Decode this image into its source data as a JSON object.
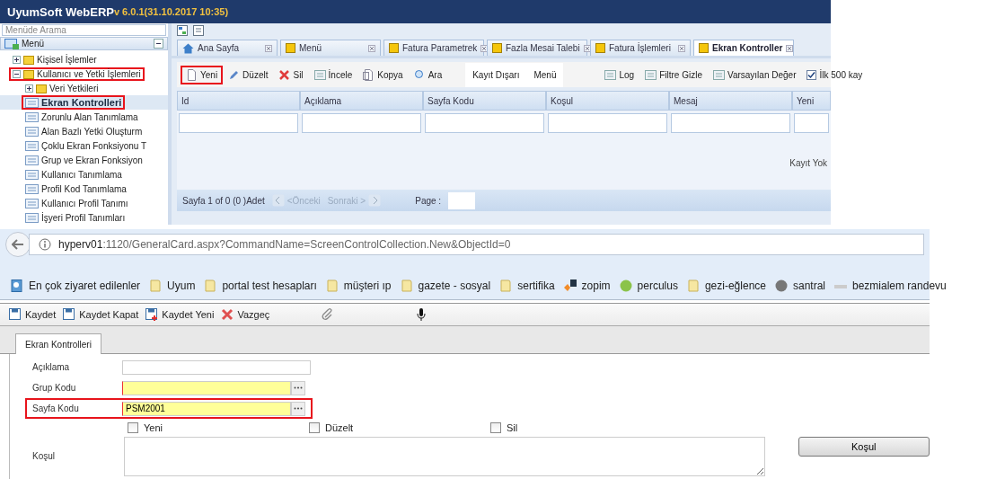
{
  "app": {
    "title": "UyumSoft WebERP",
    "version": "v 6.0.1(31.10.2017 10:35)"
  },
  "menu_search": {
    "placeholder": "Menüde Arama"
  },
  "menu": {
    "title": "Menü",
    "items": [
      {
        "label": "Kişisel İşlemler",
        "kind": "folder",
        "expanded": false,
        "selected": false,
        "highlighted": false
      },
      {
        "label": "Kullanıcı ve Yetki İşlemleri",
        "kind": "folder",
        "expanded": true,
        "selected": false,
        "highlighted": true,
        "children": [
          {
            "label": "Veri Yetkileri",
            "kind": "folder",
            "expanded": false,
            "selected": false,
            "highlighted": false
          },
          {
            "label": "Ekran Kontrolleri",
            "kind": "page",
            "selected": true,
            "highlighted": true
          },
          {
            "label": "Zorunlu Alan Tanımlama",
            "kind": "page",
            "selected": false,
            "highlighted": false
          },
          {
            "label": "Alan Bazlı Yetki Oluşturm",
            "kind": "page",
            "selected": false,
            "highlighted": false
          },
          {
            "label": "Çoklu Ekran Fonksiyonu T",
            "kind": "page",
            "selected": false,
            "highlighted": false
          },
          {
            "label": "Grup ve Ekran Fonksiyon",
            "kind": "page",
            "selected": false,
            "highlighted": false
          },
          {
            "label": "Kullanıcı Tanımlama",
            "kind": "page",
            "selected": false,
            "highlighted": false
          },
          {
            "label": "Profil Kod Tanımlama",
            "kind": "page",
            "selected": false,
            "highlighted": false
          },
          {
            "label": "Kullanıcı Profil Tanımı",
            "kind": "page",
            "selected": false,
            "highlighted": false
          },
          {
            "label": "İşyeri Profil Tanımları",
            "kind": "page",
            "selected": false,
            "highlighted": false
          }
        ]
      }
    ]
  },
  "tabs": [
    {
      "label": "Ana Sayfa",
      "kind": "home",
      "selected": false
    },
    {
      "label": "Menü",
      "kind": "page",
      "selected": false
    },
    {
      "label": "Fatura Parametrek",
      "kind": "page",
      "selected": false
    },
    {
      "label": "Fazla Mesai Talebi",
      "kind": "page",
      "selected": false
    },
    {
      "label": "Fatura İşlemleri",
      "kind": "page",
      "selected": false
    },
    {
      "label": "Ekran Kontroller",
      "kind": "page",
      "selected": true
    }
  ],
  "toolbar": [
    {
      "label": "Yeni",
      "kind": "new",
      "highlighted": true
    },
    {
      "label": "Düzelt",
      "kind": "edit",
      "highlighted": false
    },
    {
      "label": "Sil",
      "kind": "delete",
      "highlighted": false
    },
    {
      "label": "İncele",
      "kind": "view",
      "highlighted": false
    },
    {
      "label": "Kopya",
      "kind": "copy",
      "highlighted": false
    },
    {
      "label": "Ara",
      "kind": "search",
      "highlighted": false
    },
    {
      "label": "Kayıt Dışarı",
      "kind": "plain",
      "highlighted": false
    },
    {
      "label": "Menü",
      "kind": "plain",
      "highlighted": false
    },
    {
      "label": "Log",
      "kind": "log",
      "highlighted": false
    },
    {
      "label": "Filtre Gizle",
      "kind": "filter",
      "highlighted": false
    },
    {
      "label": "Varsayılan Değer",
      "kind": "default",
      "highlighted": false
    },
    {
      "label": "İlk 500 kay",
      "kind": "checkbox",
      "checked": true,
      "highlighted": false
    }
  ],
  "table": {
    "columns": [
      "Id",
      "Açıklama",
      "Sayfa Kodu",
      "Koşul",
      "Mesaj",
      "Yeni"
    ],
    "empty_text": "Kayıt Yok"
  },
  "pager": {
    "summary": "Sayfa 1 of 0 (0 )Adet",
    "previous": "<Önceki",
    "next": "Sonraki >",
    "page_label": "Page :"
  },
  "browser": {
    "url_host": "hyperv01",
    "url_rest": ":1120/GeneralCard.aspx?CommandName=ScreenControlCollection.New&ObjectId=0",
    "bookmarks": [
      {
        "label": "En çok ziyaret edilenler",
        "kind": "special"
      },
      {
        "label": "Uyum",
        "kind": "folder"
      },
      {
        "label": "portal test hesapları",
        "kind": "folder"
      },
      {
        "label": "müşteri ıp",
        "kind": "folder"
      },
      {
        "label": "gazete - sosyal",
        "kind": "folder"
      },
      {
        "label": "sertifika",
        "kind": "folder"
      },
      {
        "label": "zopim",
        "kind": "badge"
      },
      {
        "label": "perculus",
        "kind": "green"
      },
      {
        "label": "gezi-eğlence",
        "kind": "folder"
      },
      {
        "label": "santral",
        "kind": "globe"
      },
      {
        "label": "bezmialem randevu",
        "kind": "faint"
      }
    ]
  },
  "form_toolbar": [
    {
      "label": "Kaydet",
      "kind": "save"
    },
    {
      "label": "Kaydet Kapat",
      "kind": "save-close"
    },
    {
      "label": "Kaydet Yeni",
      "kind": "save-new"
    },
    {
      "label": "Vazgeç",
      "kind": "cancel"
    }
  ],
  "form": {
    "tab": "Ekran Kontrolleri",
    "fields": [
      {
        "label": "Açıklama",
        "kind": "text",
        "required": false,
        "highlighted": false
      },
      {
        "label": "Grup Kodu",
        "kind": "lookup",
        "required": true,
        "highlighted": false
      },
      {
        "label": "Sayfa Kodu",
        "kind": "lookup",
        "required": true,
        "highlighted": true,
        "value": "PSM2001"
      }
    ],
    "checkboxes": [
      {
        "label": "Yeni",
        "checked": false
      },
      {
        "label": "Düzelt",
        "checked": false
      },
      {
        "label": "Sil",
        "checked": false
      }
    ],
    "condition_label": "Koşul",
    "condition_button": "Koşul"
  }
}
